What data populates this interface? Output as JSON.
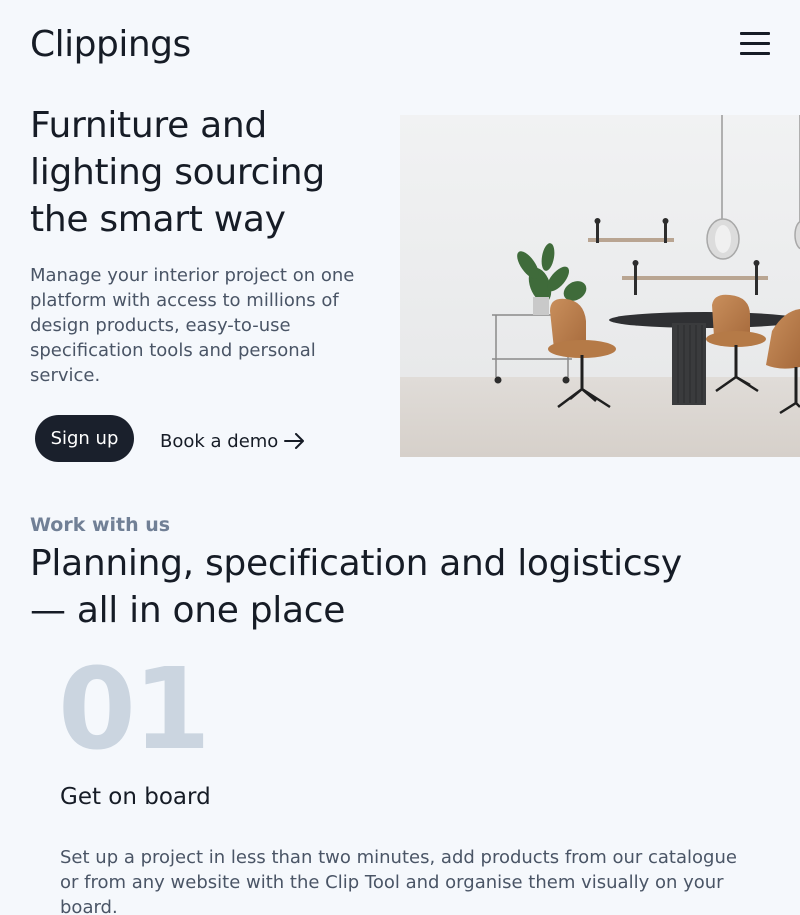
{
  "header": {
    "logo": "Clippings",
    "menu_icon": "hamburger-menu-icon"
  },
  "hero": {
    "title": "Furniture and lighting sourcing the smart way",
    "description": "Manage your interior project on one platform with access to millions of design products, easy-to-use specification tools and personal service.",
    "signup_label": "Sign up",
    "demo_label": "Book a demo",
    "demo_icon": "arrow-right-icon"
  },
  "section": {
    "eyebrow": "Work with us",
    "title": "Planning, specification and logisticsy — all in one place",
    "step": {
      "number": "01",
      "title": "Get on board",
      "description": "Set up a project in less than two minutes, add products from our catalogue or from any website with the Clip Tool and organise them visually on your board."
    }
  }
}
